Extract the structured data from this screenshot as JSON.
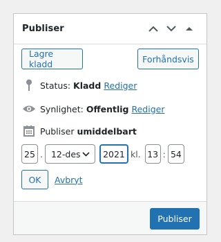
{
  "panel": {
    "title": "Publiser",
    "icons": [
      "chevron-up-icon",
      "chevron-down-icon",
      "triangle-up-icon"
    ]
  },
  "actions": {
    "save_draft": "Lagre kladd",
    "preview": "Forhåndsvis"
  },
  "status": {
    "label": "Status:",
    "value": "Kladd",
    "edit": "Rediger",
    "icon": "pin-icon"
  },
  "visibility": {
    "label": "Synlighet:",
    "value": "Offentlig",
    "edit": "Rediger",
    "icon": "eye-icon"
  },
  "schedule": {
    "label": "Publiser",
    "value": "umiddelbart",
    "icon": "calendar-icon",
    "day": "25",
    "month": "12-des",
    "year": "2021",
    "at": "kl.",
    "hour": "13",
    "minute": "54",
    "day_sep": ".",
    "time_sep": ":",
    "ok": "OK",
    "cancel": "Avbryt"
  },
  "footer": {
    "publish": "Publiser"
  },
  "colors": {
    "accent": "#2271b1",
    "icon": "#8c8f94"
  }
}
